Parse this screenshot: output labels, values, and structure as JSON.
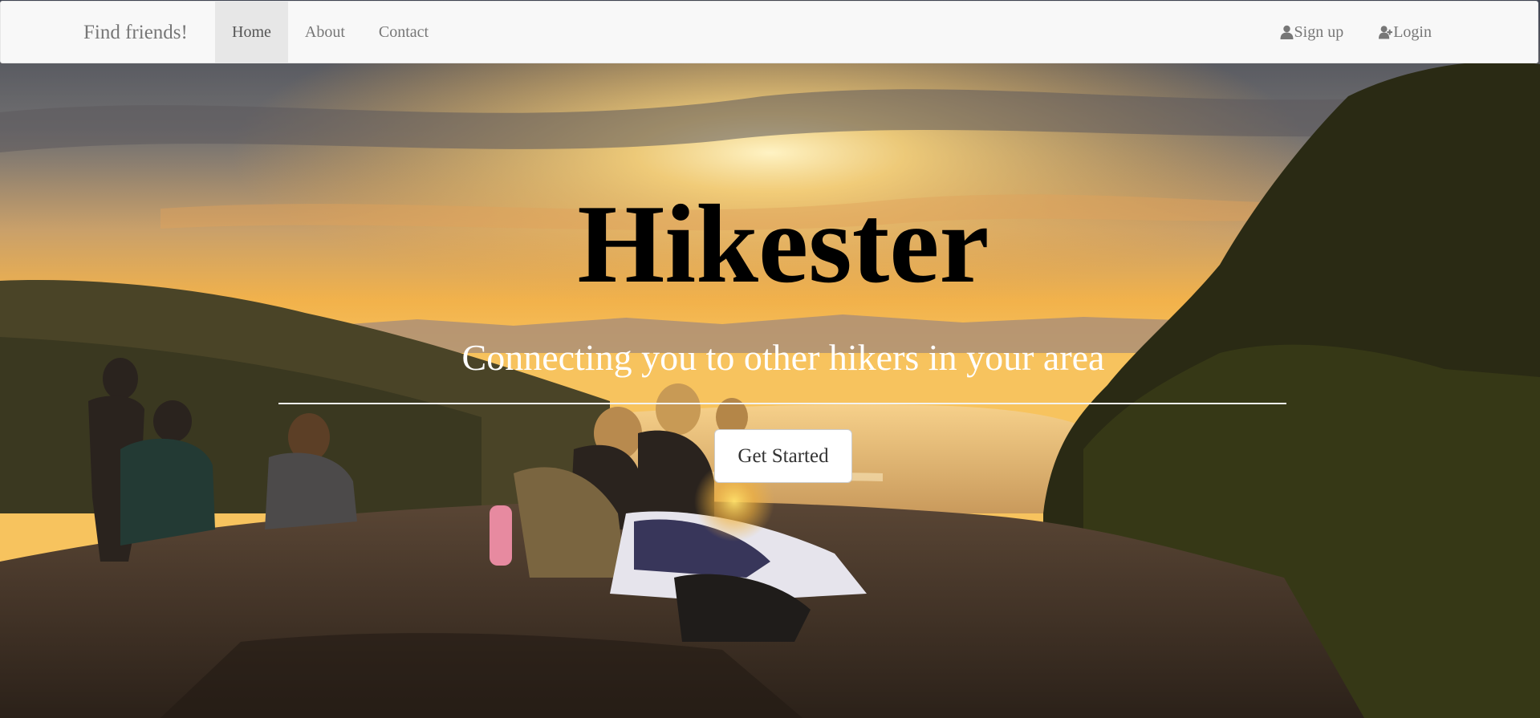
{
  "navbar": {
    "brand": "Find friends!",
    "links": [
      {
        "label": "Home",
        "active": true
      },
      {
        "label": "About",
        "active": false
      },
      {
        "label": "Contact",
        "active": false
      }
    ],
    "right_links": [
      {
        "label": "Sign up",
        "icon": "user-icon"
      },
      {
        "label": "Login",
        "icon": "user-plus-icon"
      }
    ]
  },
  "hero": {
    "title": "Hikester",
    "subtitle": "Connecting you to other hikers in your area",
    "cta_label": "Get Started",
    "background_image": "sunset-hikers-photo"
  },
  "colors": {
    "navbar_bg": "#f8f8f8",
    "nav_active_bg": "#e7e7e7",
    "nav_text": "#777777",
    "title_text": "#000000",
    "subtitle_text": "#ffffff"
  }
}
